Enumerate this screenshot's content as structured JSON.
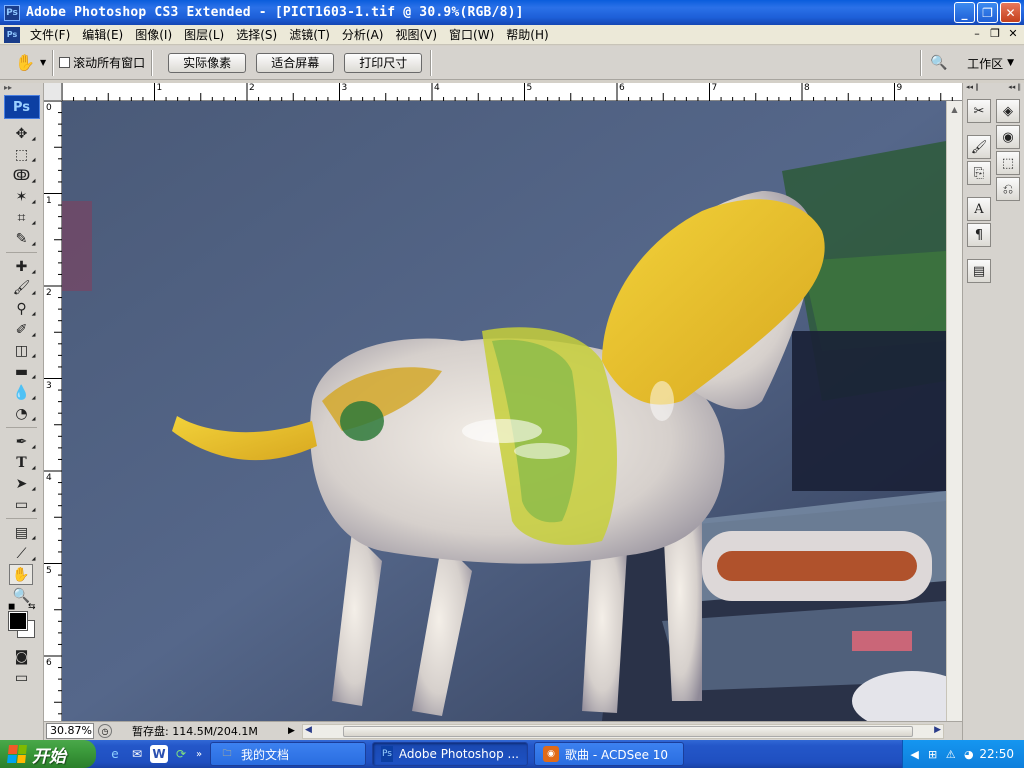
{
  "window": {
    "title": "Adobe Photoshop CS3 Extended - [PICT1603-1.tif @ 30.9%(RGB/8)]",
    "app_icon": "Ps"
  },
  "menu": {
    "items": [
      "文件(F)",
      "编辑(E)",
      "图像(I)",
      "图层(L)",
      "选择(S)",
      "滤镜(T)",
      "分析(A)",
      "视图(V)",
      "窗口(W)",
      "帮助(H)"
    ]
  },
  "options": {
    "scroll_all_windows": "滚动所有窗口",
    "actual_pixels": "实际像素",
    "fit_screen": "适合屏幕",
    "print_size": "打印尺寸",
    "workspace": "工作区"
  },
  "toolbox": {
    "logo": "Ps",
    "foreground_color": "#000000",
    "background_color": "#ffffff"
  },
  "rulers": {
    "h_labels": [
      "1",
      "2",
      "3",
      "4",
      "5",
      "6",
      "7",
      "8",
      "9"
    ],
    "v_labels": [
      "0",
      "1",
      "2",
      "3",
      "4",
      "5",
      "6"
    ]
  },
  "status": {
    "zoom": "30.87%",
    "scratch": "暂存盘: 114.5M/204.1M"
  },
  "taskbar": {
    "start": "开始",
    "tasks": [
      {
        "label": "我的文档",
        "icon": "folder-icon"
      },
      {
        "label": "Adobe Photoshop ...",
        "icon": "ps-icon"
      },
      {
        "label": "歌曲 - ACDSee 10",
        "icon": "acdsee-icon"
      }
    ],
    "clock": "22:50"
  }
}
